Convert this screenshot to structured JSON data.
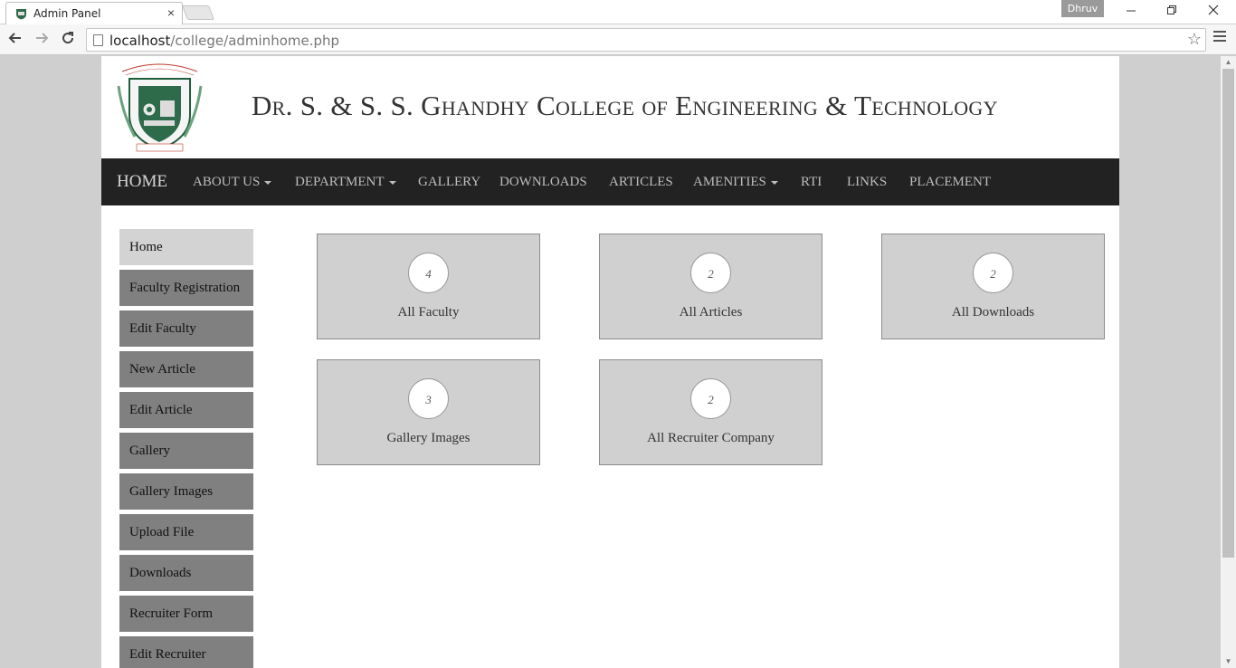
{
  "browser": {
    "tab_title": "Admin Panel",
    "tab_close": "×",
    "profile_name": "Dhruv",
    "url_host": "localhost",
    "url_path": "/college/adminhome.php"
  },
  "site": {
    "college_name": "Dr. S. & S. S. Ghandhy College of Engineering & Technology"
  },
  "navbar": {
    "home": "HOME",
    "about": "ABOUT US",
    "department": "DEPARTMENT",
    "gallery": "GALLERY",
    "downloads": "DOWNLOADS",
    "articles": "ARTICLES",
    "amenities": "AMENITIES",
    "rti": "RTI",
    "links": "LINKS",
    "placement": "PLACEMENT"
  },
  "sidebar": {
    "items": [
      {
        "label": "Home"
      },
      {
        "label": "Faculty Registration"
      },
      {
        "label": "Edit Faculty"
      },
      {
        "label": "New Article"
      },
      {
        "label": "Edit Article"
      },
      {
        "label": "Gallery"
      },
      {
        "label": "Gallery Images"
      },
      {
        "label": "Upload File"
      },
      {
        "label": "Downloads"
      },
      {
        "label": "Recruiter Form"
      },
      {
        "label": "Edit Recruiter"
      }
    ]
  },
  "cards": [
    {
      "count": "4",
      "label": "All Faculty"
    },
    {
      "count": "2",
      "label": "All Articles"
    },
    {
      "count": "2",
      "label": "All Downloads"
    },
    {
      "count": "3",
      "label": "Gallery Images"
    },
    {
      "count": "2",
      "label": "All Recruiter Company"
    }
  ],
  "colors": {
    "navbar_bg": "#222222",
    "sidebar_item_bg": "#808080",
    "sidebar_active_bg": "#d3d3d3",
    "card_bg": "#d0d0d0"
  }
}
